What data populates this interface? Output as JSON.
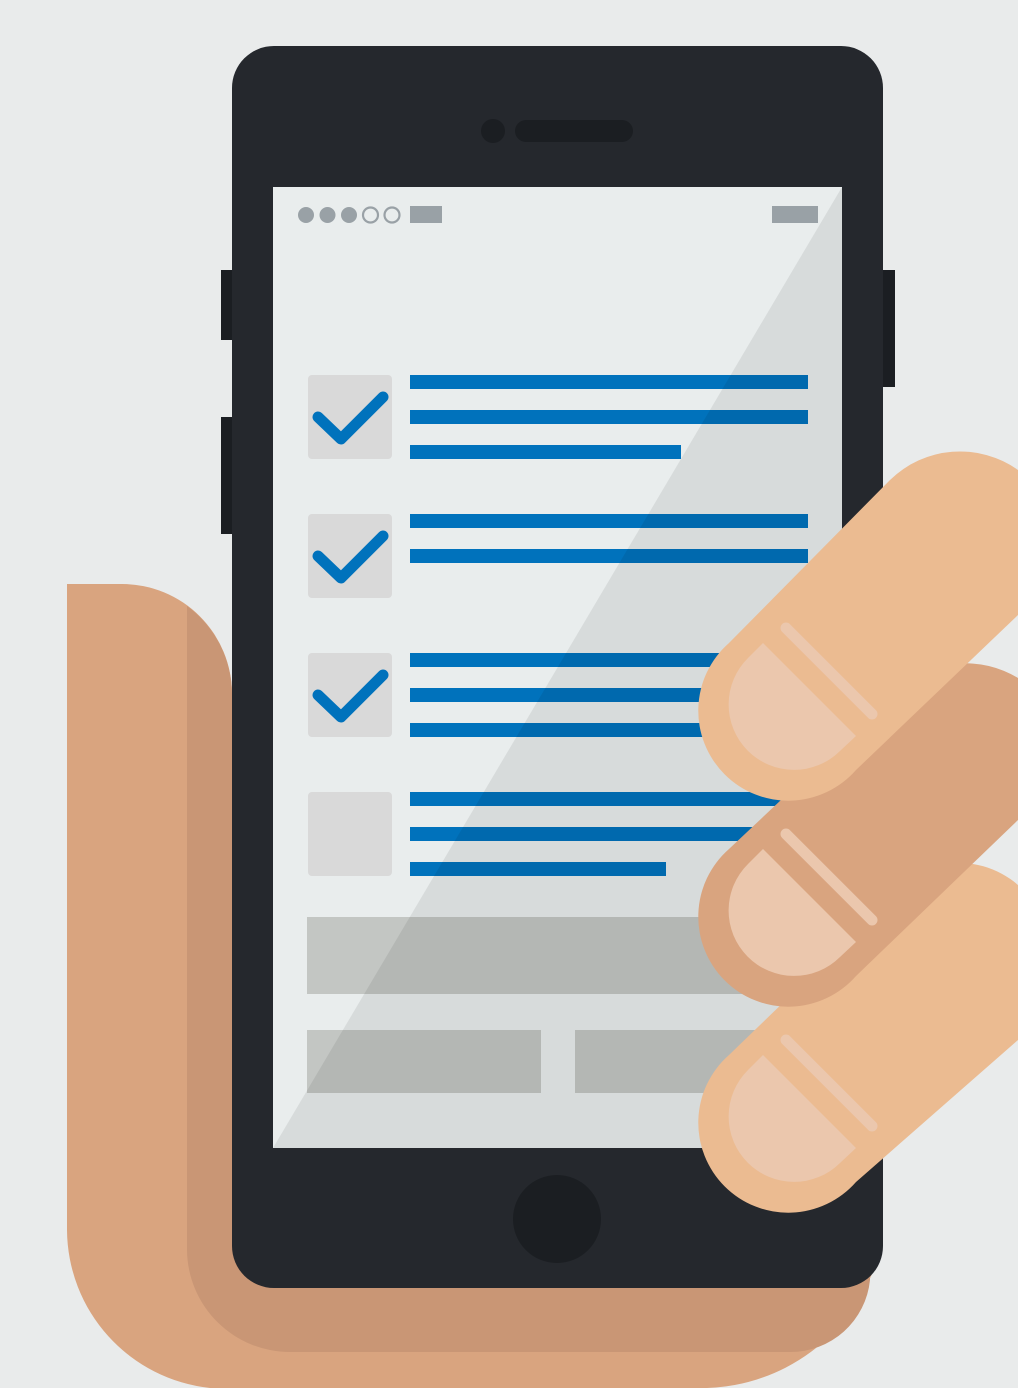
{
  "illustration": {
    "subject": "hand-holding-phone-with-checklist",
    "colors": {
      "background": "#e9ebeb",
      "phone_body": "#25282d",
      "phone_dark_detail": "#1b1e22",
      "screen": "#e9eded",
      "status_gray": "#99a1a6",
      "checkbox": "#d9d9d9",
      "accent_blue": "#0072bc",
      "button_gray": "#c3c6c3",
      "skin_light": "#ebbb91",
      "skin_mid": "#d9a47f",
      "skin_shadow": "#c99675",
      "fingernail": "#ebc7ad"
    },
    "status_bar": {
      "signal_dots_filled": 3,
      "signal_dots_total": 5
    },
    "checklist": {
      "items": [
        {
          "checked": true,
          "line_count": 3
        },
        {
          "checked": true,
          "line_count": 2
        },
        {
          "checked": true,
          "line_count": 3
        },
        {
          "checked": false,
          "line_count": 3
        }
      ]
    },
    "icons": [
      "check-icon",
      "signal-dots-icon",
      "battery-icon",
      "home-button-icon"
    ]
  }
}
